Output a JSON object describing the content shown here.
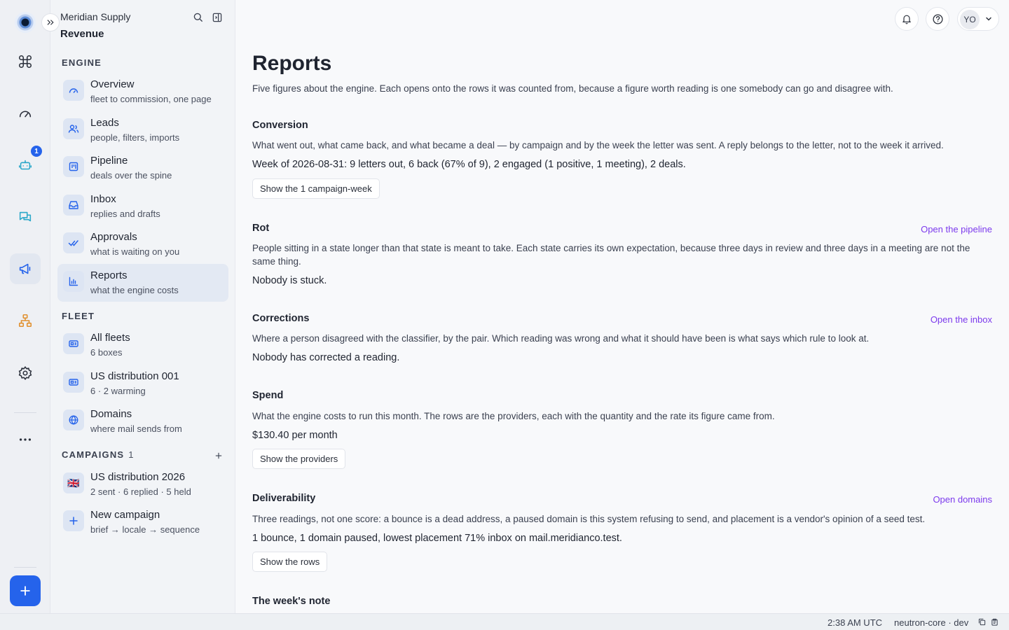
{
  "workspace": {
    "org": "Meridian Supply",
    "title": "Revenue"
  },
  "rail": {
    "bot_badge": "1",
    "items": [
      "command-icon",
      "gauge-icon",
      "bot-icon",
      "chat-icon",
      "megaphone-icon",
      "org-chart-icon",
      "gear-icon",
      "more-icon"
    ],
    "active": "megaphone-icon"
  },
  "sidebar": {
    "engine_label": "ENGINE",
    "engine": [
      {
        "label": "Overview",
        "sub": "fleet to commission, one page",
        "icon": "gauge-icon"
      },
      {
        "label": "Leads",
        "sub": "people, filters, imports",
        "icon": "people-icon"
      },
      {
        "label": "Pipeline",
        "sub": "deals over the spine",
        "icon": "kanban-icon"
      },
      {
        "label": "Inbox",
        "sub": "replies and drafts",
        "icon": "inbox-icon"
      },
      {
        "label": "Approvals",
        "sub": "what is waiting on you",
        "icon": "double-check-icon"
      },
      {
        "label": "Reports",
        "sub": "what the engine costs",
        "icon": "bar-chart-icon"
      }
    ],
    "fleet_label": "FLEET",
    "fleet": [
      {
        "label": "All fleets",
        "sub": "6 boxes",
        "icon": "fleet-icon"
      },
      {
        "label": "US distribution 001",
        "sub": "6 · 2 warming",
        "icon": "fleet-icon"
      },
      {
        "label": "Domains",
        "sub": "where mail sends from",
        "icon": "globe-icon"
      }
    ],
    "campaigns_label": "CAMPAIGNS",
    "campaigns_count": "1",
    "campaigns": [
      {
        "label": "US distribution 2026",
        "sub": "2 sent · 6 replied · 5 held",
        "flag": "🇬🇧"
      },
      {
        "label": "New campaign",
        "sub": "brief → locale → sequence",
        "icon": "plus-icon"
      }
    ]
  },
  "header": {
    "avatar_initials": "YO"
  },
  "page": {
    "title": "Reports",
    "description": "Five figures about the engine. Each opens onto the rows it was counted from, because a figure worth reading is one somebody can go and disagree with.",
    "sections": {
      "conversion": {
        "title": "Conversion",
        "description": "What went out, what came back, and what became a deal — by campaign and by the week the letter was sent. A reply belongs to the letter, not to the week it arrived.",
        "figure": "Week of 2026-08-31: 9 letters out, 6 back (67% of 9), 2 engaged (1 positive, 1 meeting), 2 deals.",
        "button": "Show the 1 campaign-week"
      },
      "rot": {
        "title": "Rot",
        "link": "Open the pipeline",
        "description": "People sitting in a state longer than that state is meant to take. Each state carries its own expectation, because three days in review and three days in a meeting are not the same thing.",
        "figure": "Nobody is stuck."
      },
      "corrections": {
        "title": "Corrections",
        "link": "Open the inbox",
        "description": "Where a person disagreed with the classifier, by the pair. Which reading was wrong and what it should have been is what says which rule to look at.",
        "figure": "Nobody has corrected a reading."
      },
      "spend": {
        "title": "Spend",
        "description": "What the engine costs to run this month. The rows are the providers, each with the quantity and the rate its figure came from.",
        "figure": "$130.40 per month",
        "button": "Show the providers"
      },
      "deliverability": {
        "title": "Deliverability",
        "link": "Open domains",
        "description": "Three readings, not one score: a bounce is a dead address, a paused domain is this system refusing to send, and placement is a vendor's opinion of a seed test.",
        "figure": "1 bounce, 1 domain paused, lowest placement 71% inbox on mail.meridianco.test.",
        "button": "Show the rows"
      },
      "note": {
        "title": "The week's note"
      }
    }
  },
  "status": {
    "time": "2:38 AM UTC",
    "env": "neutron-core · dev"
  },
  "colors": {
    "accent": "#2563eb",
    "link": "#7c3aed",
    "rail_bg": "#eef0f4",
    "sidebar_bg": "#f2f4f7"
  }
}
